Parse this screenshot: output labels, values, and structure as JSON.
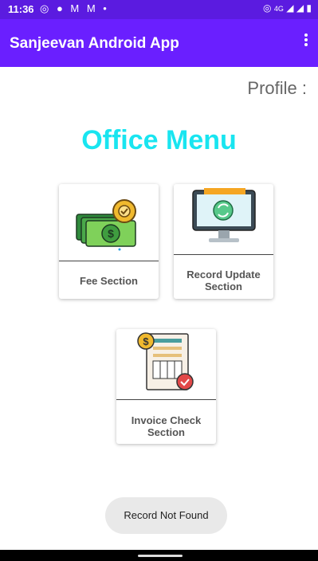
{
  "status": {
    "time": "11:36",
    "network": "4G"
  },
  "appbar": {
    "title": "Sanjeevan Android App"
  },
  "profile_label": "Profile :",
  "heading": "Office Menu",
  "cards": {
    "fee": {
      "label": "Fee Section"
    },
    "record_update": {
      "label": "Record Update Section"
    },
    "invoice_check": {
      "label": "Invoice Check Section"
    }
  },
  "toast": {
    "text": "Record Not Found"
  },
  "colors": {
    "statusbar": "#5b1be0",
    "appbar": "#6a1fff",
    "heading": "#19e5f0"
  }
}
